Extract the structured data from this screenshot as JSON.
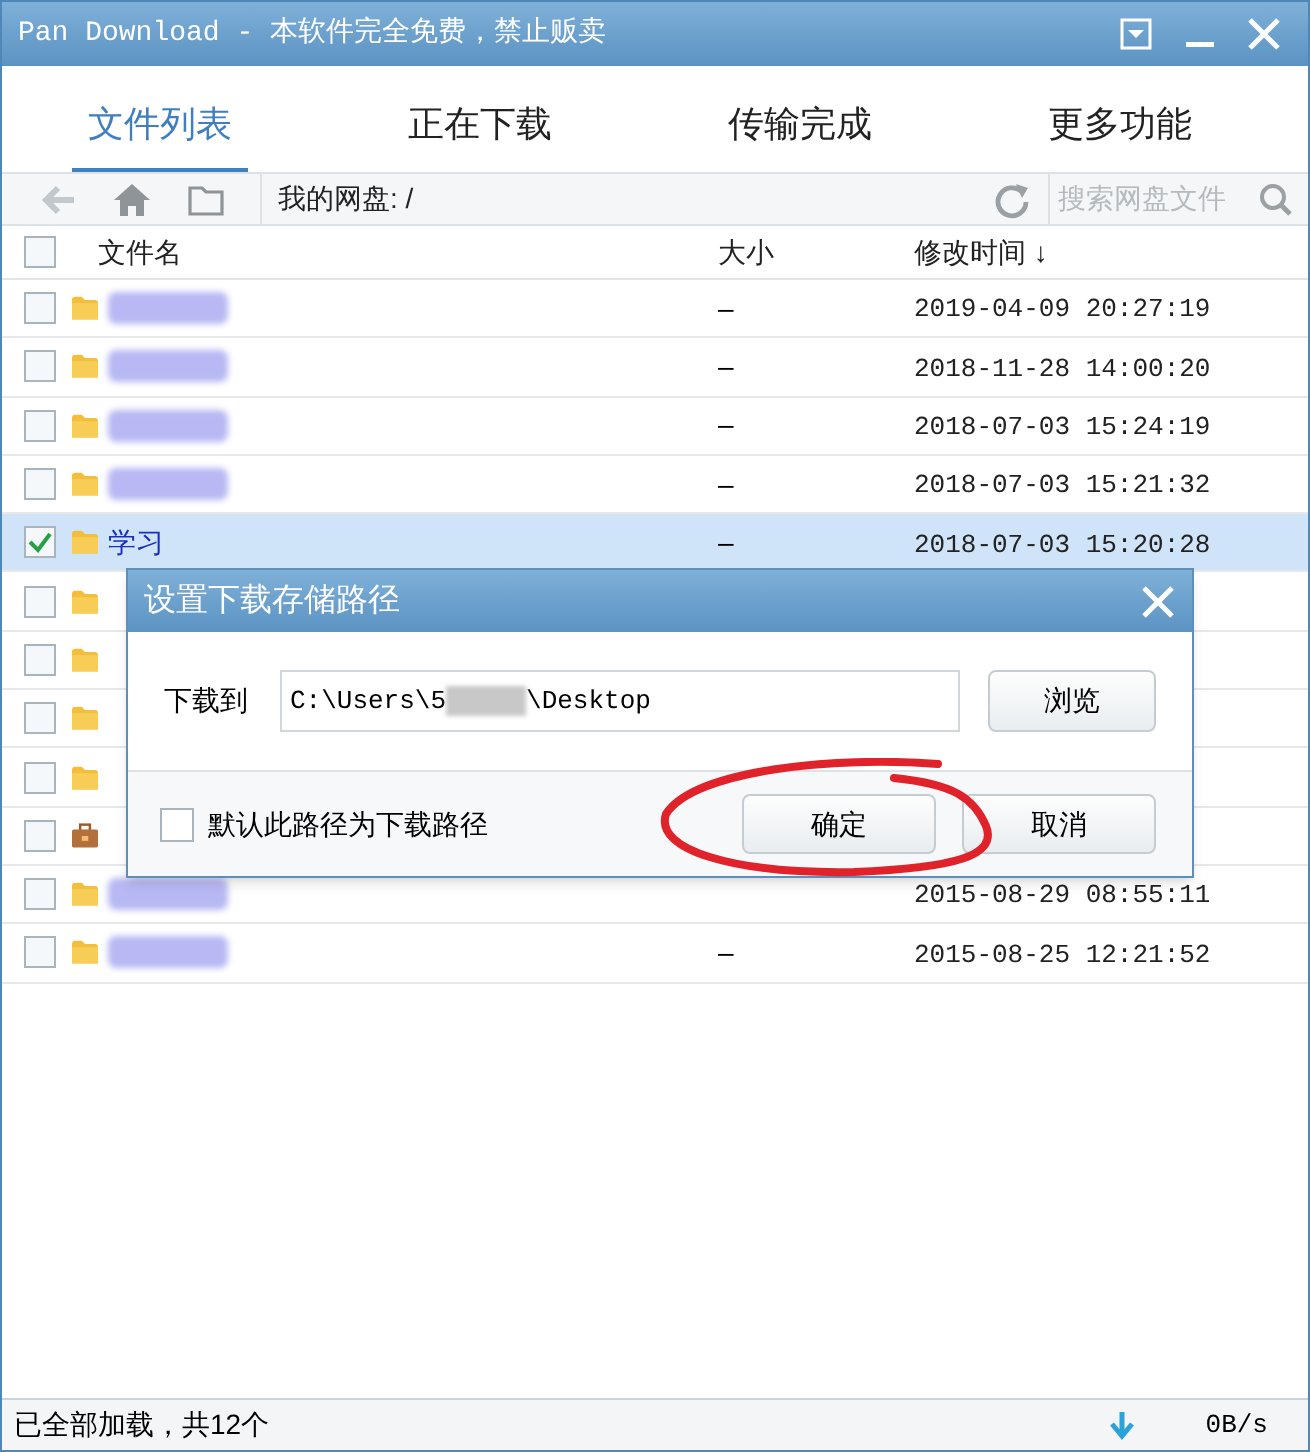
{
  "window": {
    "title": "Pan Download - 本软件完全免费，禁止贩卖"
  },
  "tabs": [
    {
      "label": "文件列表",
      "selected": true
    },
    {
      "label": "正在下载",
      "selected": false
    },
    {
      "label": "传输完成",
      "selected": false
    },
    {
      "label": "更多功能",
      "selected": false
    }
  ],
  "toolbar": {
    "path": "我的网盘: /",
    "search": {
      "placeholder": "搜索网盘文件"
    }
  },
  "table": {
    "select_all_checked": false,
    "columns": [
      "文件名",
      "大小",
      "修改时间 ↓"
    ],
    "rows": [
      {
        "kind": "folder",
        "redacted": true,
        "size": "–",
        "modified": "2019-04-09 20:27:19",
        "checked": false,
        "selected": false
      },
      {
        "kind": "folder",
        "redacted": true,
        "size": "–",
        "modified": "2018-11-28 14:00:20",
        "checked": false,
        "selected": false
      },
      {
        "kind": "folder",
        "redacted": true,
        "size": "–",
        "modified": "2018-07-03 15:24:19",
        "checked": false,
        "selected": false
      },
      {
        "kind": "folder",
        "redacted": true,
        "size": "–",
        "modified": "2018-07-03 15:21:32",
        "checked": false,
        "selected": false
      },
      {
        "kind": "folder",
        "name": "学习",
        "size": "–",
        "modified": "2018-07-03 15:20:28",
        "checked": true,
        "selected": true
      },
      {
        "kind": "folder",
        "checked": false,
        "selected": false
      },
      {
        "kind": "folder",
        "checked": false,
        "selected": false
      },
      {
        "kind": "folder",
        "checked": false,
        "selected": false
      },
      {
        "kind": "folder",
        "checked": false,
        "selected": false
      },
      {
        "kind": "briefcase",
        "checked": false,
        "selected": false
      },
      {
        "kind": "folder",
        "redacted": true,
        "modified": "2015-08-29 08:55:11",
        "checked": false,
        "selected": false
      },
      {
        "kind": "folder",
        "redacted": true,
        "size": "–",
        "modified": "2015-08-25 12:21:52",
        "checked": false,
        "selected": false
      }
    ]
  },
  "dialog": {
    "title": "设置下载存储路径",
    "label": "下载到",
    "path": "C:\\Users\\5",
    "path_end": "\\Desktop",
    "browse": "浏览",
    "default_checkbox": {
      "label": "默认此路径为下载路径",
      "checked": false
    },
    "buttons": [
      "确定",
      "取消"
    ]
  },
  "status_bar": {
    "text": "已全部加载，共12个",
    "speed": "0B/s"
  }
}
